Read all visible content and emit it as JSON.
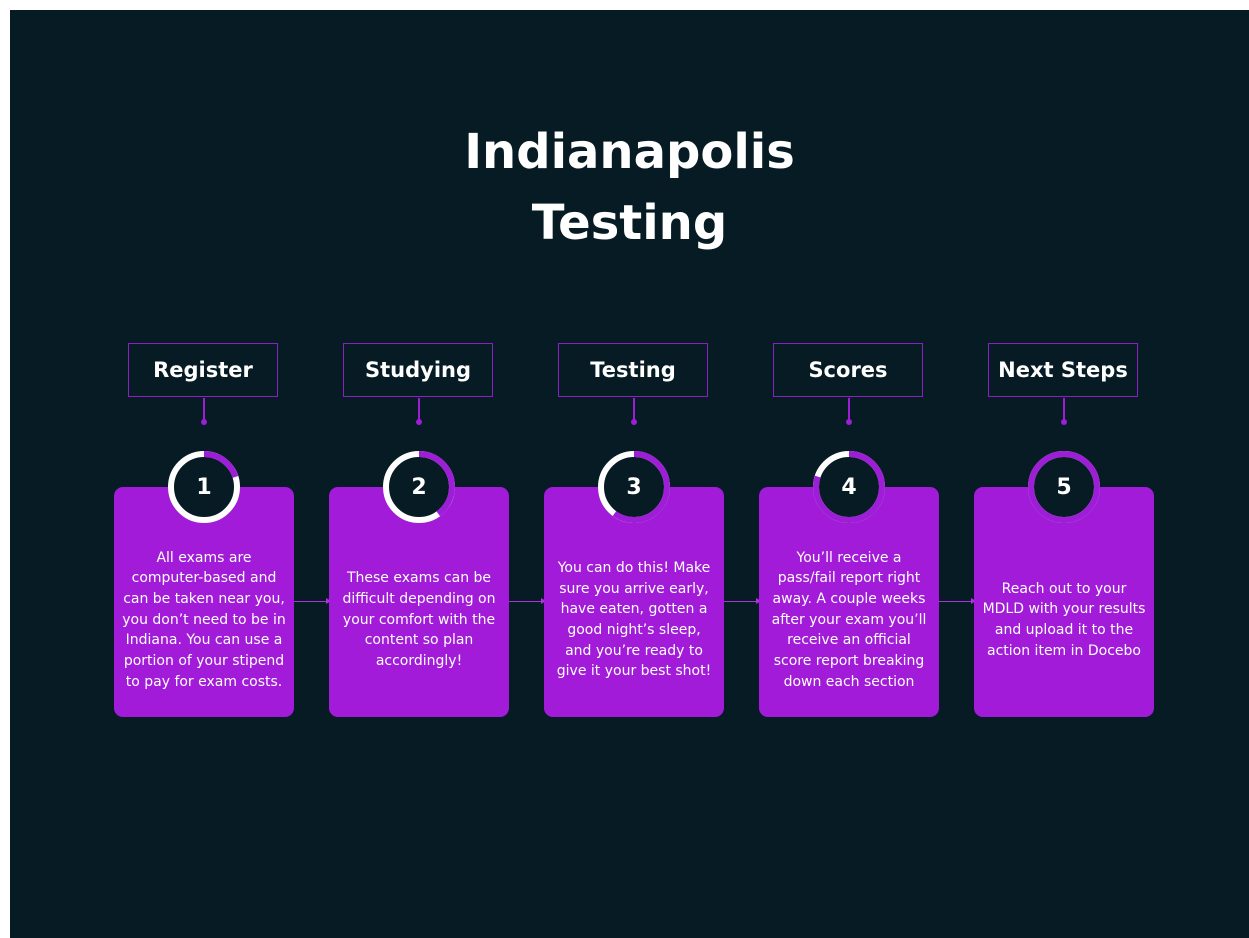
{
  "title": {
    "line1": "Indianapolis",
    "line2": "Testing"
  },
  "colors": {
    "background": "#061b24",
    "card": "#a21bd8",
    "accent": "#9d1ed6",
    "badge_track": "#ffffff",
    "badge_progress": "#9d1ed6"
  },
  "steps": [
    {
      "label": "Register",
      "number": "1",
      "progress": 0.2,
      "text": "All exams are computer-based and can be taken near you, you don’t need to be in Indiana. You can use a portion of your stipend to pay for exam costs."
    },
    {
      "label": "Studying",
      "number": "2",
      "progress": 0.4,
      "text": "These exams can be difficult depending on your comfort with the content so plan accordingly!"
    },
    {
      "label": "Testing",
      "number": "3",
      "progress": 0.6,
      "text": "You can do this! Make sure you arrive early, have eaten, gotten a good night’s sleep, and you’re ready to give it your best shot!"
    },
    {
      "label": "Scores",
      "number": "4",
      "progress": 0.8,
      "text": "You’ll receive a pass/fail report right away. A couple weeks after your exam you’ll receive an official score report breaking down each section"
    },
    {
      "label": "Next Steps",
      "number": "5",
      "progress": 1.0,
      "text": "Reach out to your MDLD with your results and upload it to the action item in Docebo"
    }
  ]
}
